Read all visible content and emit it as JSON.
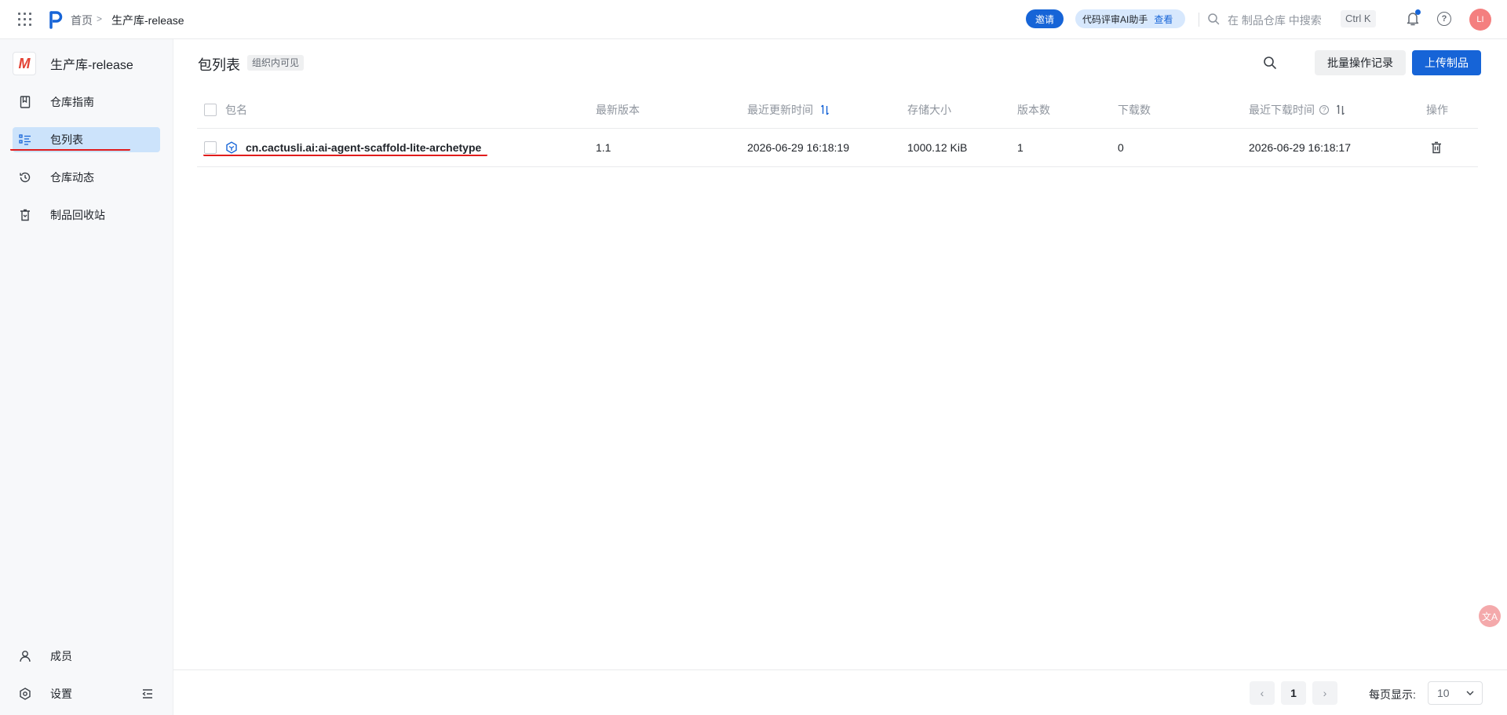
{
  "topbar": {
    "breadcrumb_home": "首页",
    "breadcrumb_sep": ">",
    "breadcrumb_current": "生产库-release",
    "invite_label": "邀请",
    "ai_pill_label": "代码评审AI助手",
    "ai_pill_view": "查看",
    "search_hint": "在 制品仓库 中搜索",
    "shortcut": "Ctrl K",
    "help_glyph": "?",
    "avatar_text": "LI"
  },
  "sidebar": {
    "repo_logo": "M",
    "repo_name": "生产库-release",
    "items": [
      {
        "label": "仓库指南",
        "icon": "book-icon"
      },
      {
        "label": "包列表",
        "icon": "list-icon",
        "active": true
      },
      {
        "label": "仓库动态",
        "icon": "history-icon"
      },
      {
        "label": "制品回收站",
        "icon": "recycle-icon"
      }
    ],
    "bottom": [
      {
        "label": "成员",
        "icon": "user-icon"
      },
      {
        "label": "设置",
        "icon": "gear-icon"
      }
    ]
  },
  "main": {
    "title": "包列表",
    "visibility": "组织内可见",
    "batch_label": "批量操作记录",
    "upload_label": "上传制品",
    "columns": {
      "name": "包名",
      "latest_version": "最新版本",
      "updated": "最近更新时间",
      "size": "存储大小",
      "versions": "版本数",
      "downloads": "下载数",
      "last_download": "最近下载时间",
      "actions": "操作"
    },
    "rows": [
      {
        "name": "cn.cactusli.ai:ai-agent-scaffold-lite-archetype",
        "latest_version": "1.1",
        "updated": "2026-06-29 16:18:19",
        "size": "1000.12 KiB",
        "versions": "1",
        "downloads": "0",
        "last_download": "2026-06-29 16:18:17"
      }
    ]
  },
  "pagination": {
    "prev": "‹",
    "current_page": "1",
    "next": "›",
    "per_page_label": "每页显示:",
    "per_page_value": "10"
  },
  "fab": {
    "label": "文A"
  },
  "colors": {
    "accent": "#1664d7",
    "active_nav": "#cce3fb",
    "annotation_red": "#e11c1c",
    "avatar": "#f47f7f"
  }
}
